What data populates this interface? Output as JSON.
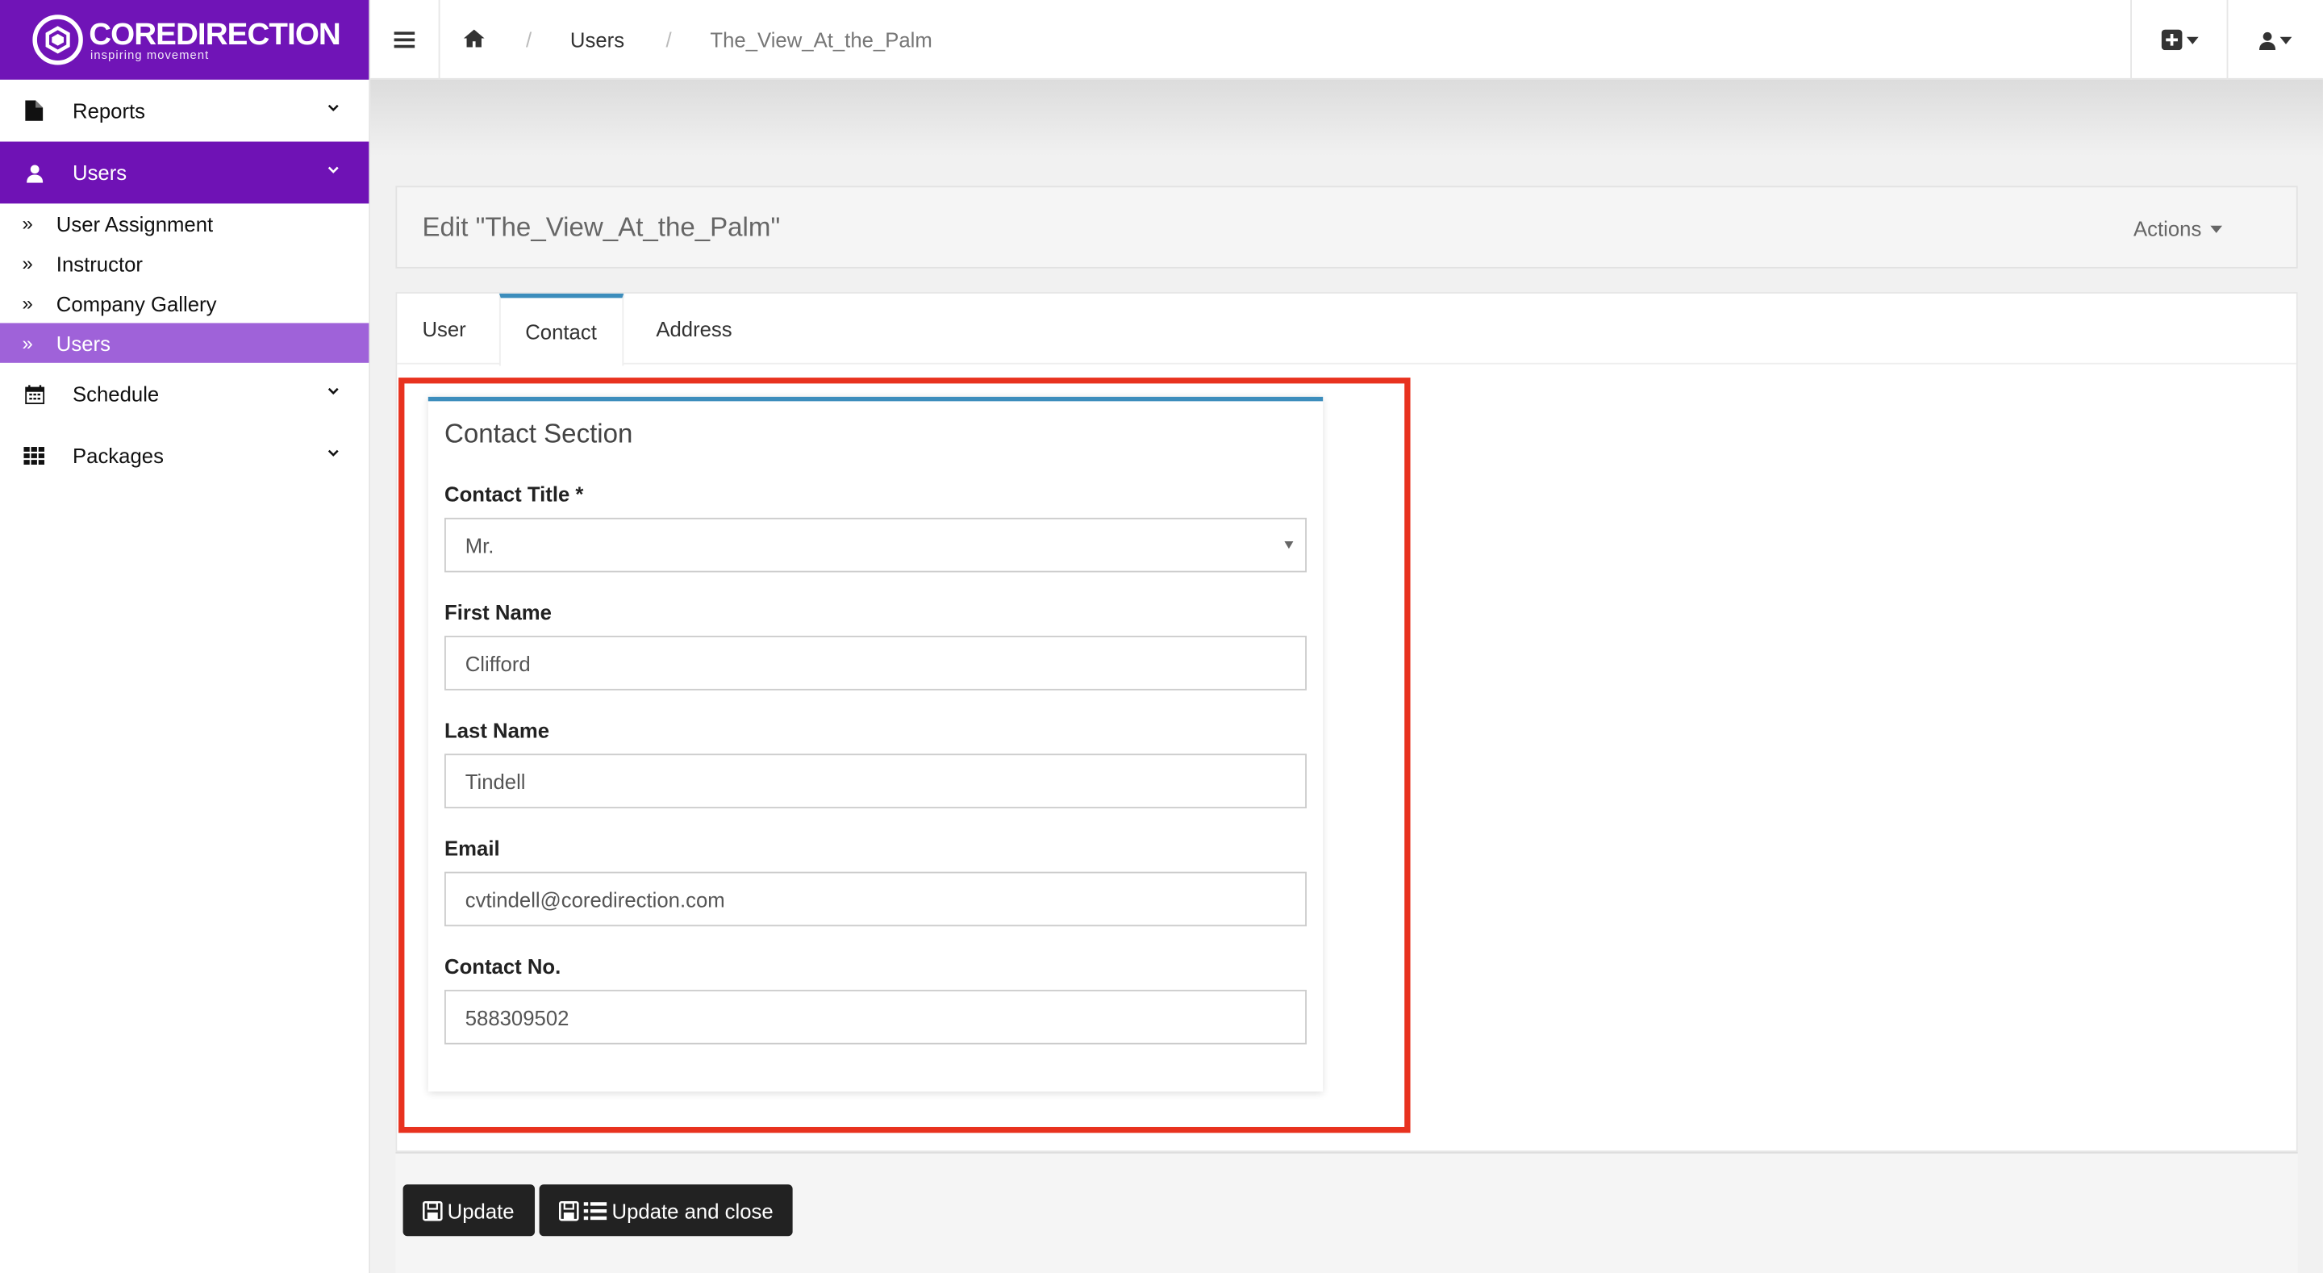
{
  "brand": {
    "name": "COREDIRECTION",
    "tagline": "inspiring movement",
    "color": "#7014b7"
  },
  "sidebar": {
    "items": [
      {
        "label": "Reports",
        "icon": "file-icon"
      },
      {
        "label": "Users",
        "icon": "user-icon",
        "active": true
      },
      {
        "label": "Schedule",
        "icon": "calendar-icon"
      },
      {
        "label": "Packages",
        "icon": "grid-icon"
      }
    ],
    "users_submenu": [
      {
        "label": "User Assignment"
      },
      {
        "label": "Instructor"
      },
      {
        "label": "Company Gallery"
      },
      {
        "label": "Users",
        "active": true
      }
    ]
  },
  "topbar": {
    "breadcrumb": {
      "home_icon": "home-icon",
      "users": "Users",
      "current": "The_View_At_the_Palm"
    },
    "right_icons": [
      "plus-square-icon",
      "user-icon"
    ]
  },
  "page": {
    "title": "Edit \"The_View_At_the_Palm\"",
    "actions_label": "Actions"
  },
  "tabs": [
    {
      "label": "User"
    },
    {
      "label": "Contact",
      "active": true
    },
    {
      "label": "Address"
    }
  ],
  "contact_section": {
    "title": "Contact Section",
    "contact_title": {
      "label": "Contact Title *",
      "value": "Mr."
    },
    "first_name": {
      "label": "First Name",
      "value": "Clifford"
    },
    "last_name": {
      "label": "Last Name",
      "value": "Tindell"
    },
    "email": {
      "label": "Email",
      "value": "cvtindell@coredirection.com"
    },
    "contact_no": {
      "label": "Contact No.",
      "value": "588309502"
    }
  },
  "footer": {
    "update_label": "Update",
    "update_close_label": "Update and close"
  },
  "colors": {
    "accent": "#3c8dbc",
    "sidebar_active": "#6f12b5",
    "submenu_active": "#9f62d9",
    "highlight": "#e8321f"
  }
}
